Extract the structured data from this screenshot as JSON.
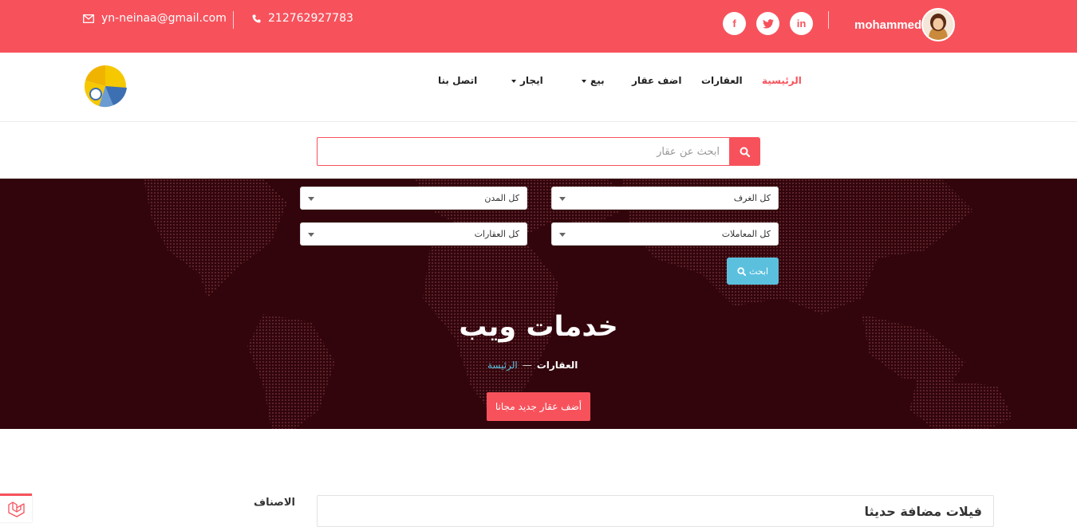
{
  "topbar": {
    "email": "yn-neinaa@gmail.com",
    "phone": "212762927783",
    "username": "mohammed",
    "social": [
      {
        "icon": "facebook-icon",
        "glyph": "f"
      },
      {
        "icon": "twitter-icon",
        "glyph": "t"
      },
      {
        "icon": "linkedin-icon",
        "glyph": "in"
      }
    ],
    "background": "#f7525c"
  },
  "nav": {
    "home": "الرئيسية",
    "properties": "العقارات",
    "add_property": "اضف عقار",
    "sale": "بيع",
    "rent": "ايجار",
    "contact": "اتصل بنا",
    "active_color": "#f7525c"
  },
  "search": {
    "placeholder": "ابحث عن عقار"
  },
  "filters": {
    "rooms": "كل الغرف",
    "cities": "كل المدن",
    "transactions": "كل المعاملات",
    "property_types": "كل العقارات",
    "search_button": "ابحث"
  },
  "hero": {
    "title": "خدمات ويب",
    "breadcrumb_current": "العقارات",
    "breadcrumb_home": "الرئيسة",
    "breadcrumb_separator": "—",
    "add_button": "أضف عقار جديد مجانا",
    "background": "#32050c",
    "accent": "#5bc0de"
  },
  "sidebar": {
    "categories_title": "الاصناف"
  },
  "main": {
    "recent_title": "فيلات مضافة حديثا"
  }
}
